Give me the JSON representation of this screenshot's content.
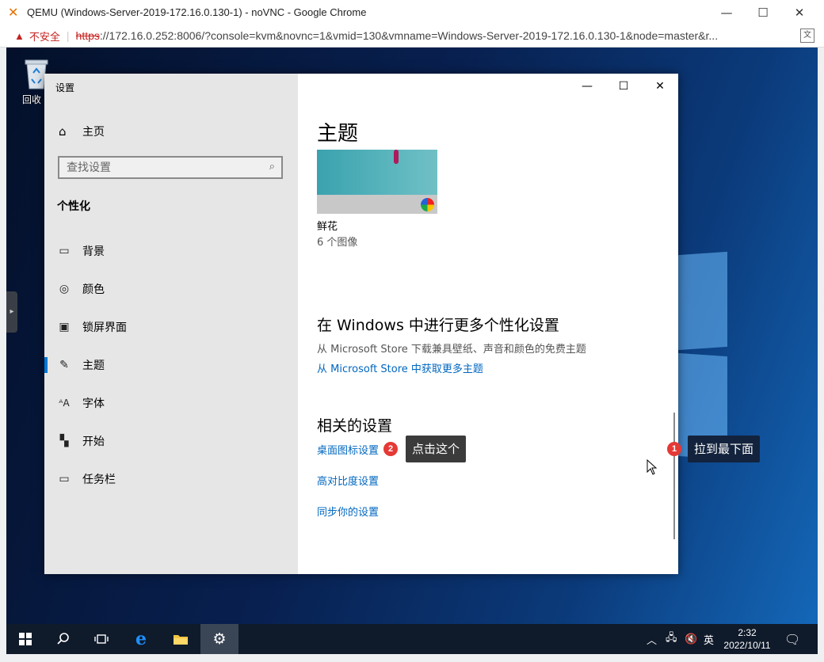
{
  "browser": {
    "title": "QEMU (Windows-Server-2019-172.16.0.130-1) - noVNC - Google Chrome",
    "security_label": "不安全",
    "url_scheme": "https",
    "url_rest": "://172.16.0.252:8006/?console=kvm&novnc=1&vmid=130&vmname=Windows-Server-2019-172.16.0.130-1&node=master&r..."
  },
  "desktop": {
    "recycle_label": "回收"
  },
  "settings": {
    "app_title": "设置",
    "home_label": "主页",
    "search_placeholder": "查找设置",
    "section_heading": "个性化",
    "nav": [
      {
        "label": "背景",
        "icon": "image-icon"
      },
      {
        "label": "颜色",
        "icon": "palette-icon"
      },
      {
        "label": "锁屏界面",
        "icon": "lock-screen-icon"
      },
      {
        "label": "主题",
        "icon": "theme-icon",
        "active": true
      },
      {
        "label": "字体",
        "icon": "font-icon"
      },
      {
        "label": "开始",
        "icon": "start-icon"
      },
      {
        "label": "任务栏",
        "icon": "taskbar-icon"
      }
    ],
    "page_title": "主题",
    "theme": {
      "name": "鲜花",
      "count": "6 个图像"
    },
    "more_heading": "在 Windows 中进行更多个性化设置",
    "more_desc": "从 Microsoft Store 下载兼具壁纸、声音和颜色的免费主题",
    "more_link": "从 Microsoft Store 中获取更多主题",
    "related_heading": "相关的设置",
    "related_links": [
      "桌面图标设置",
      "高对比度设置",
      "同步你的设置"
    ]
  },
  "annotations": {
    "badge1": "1",
    "tip1": "拉到最下面",
    "badge2": "2",
    "tip2": "点击这个"
  },
  "taskbar": {
    "ime": "英",
    "time": "2:32",
    "date": "2022/10/11"
  },
  "colors": {
    "accent": "#0078d7",
    "link": "#0067c0",
    "badge": "#e53935"
  }
}
